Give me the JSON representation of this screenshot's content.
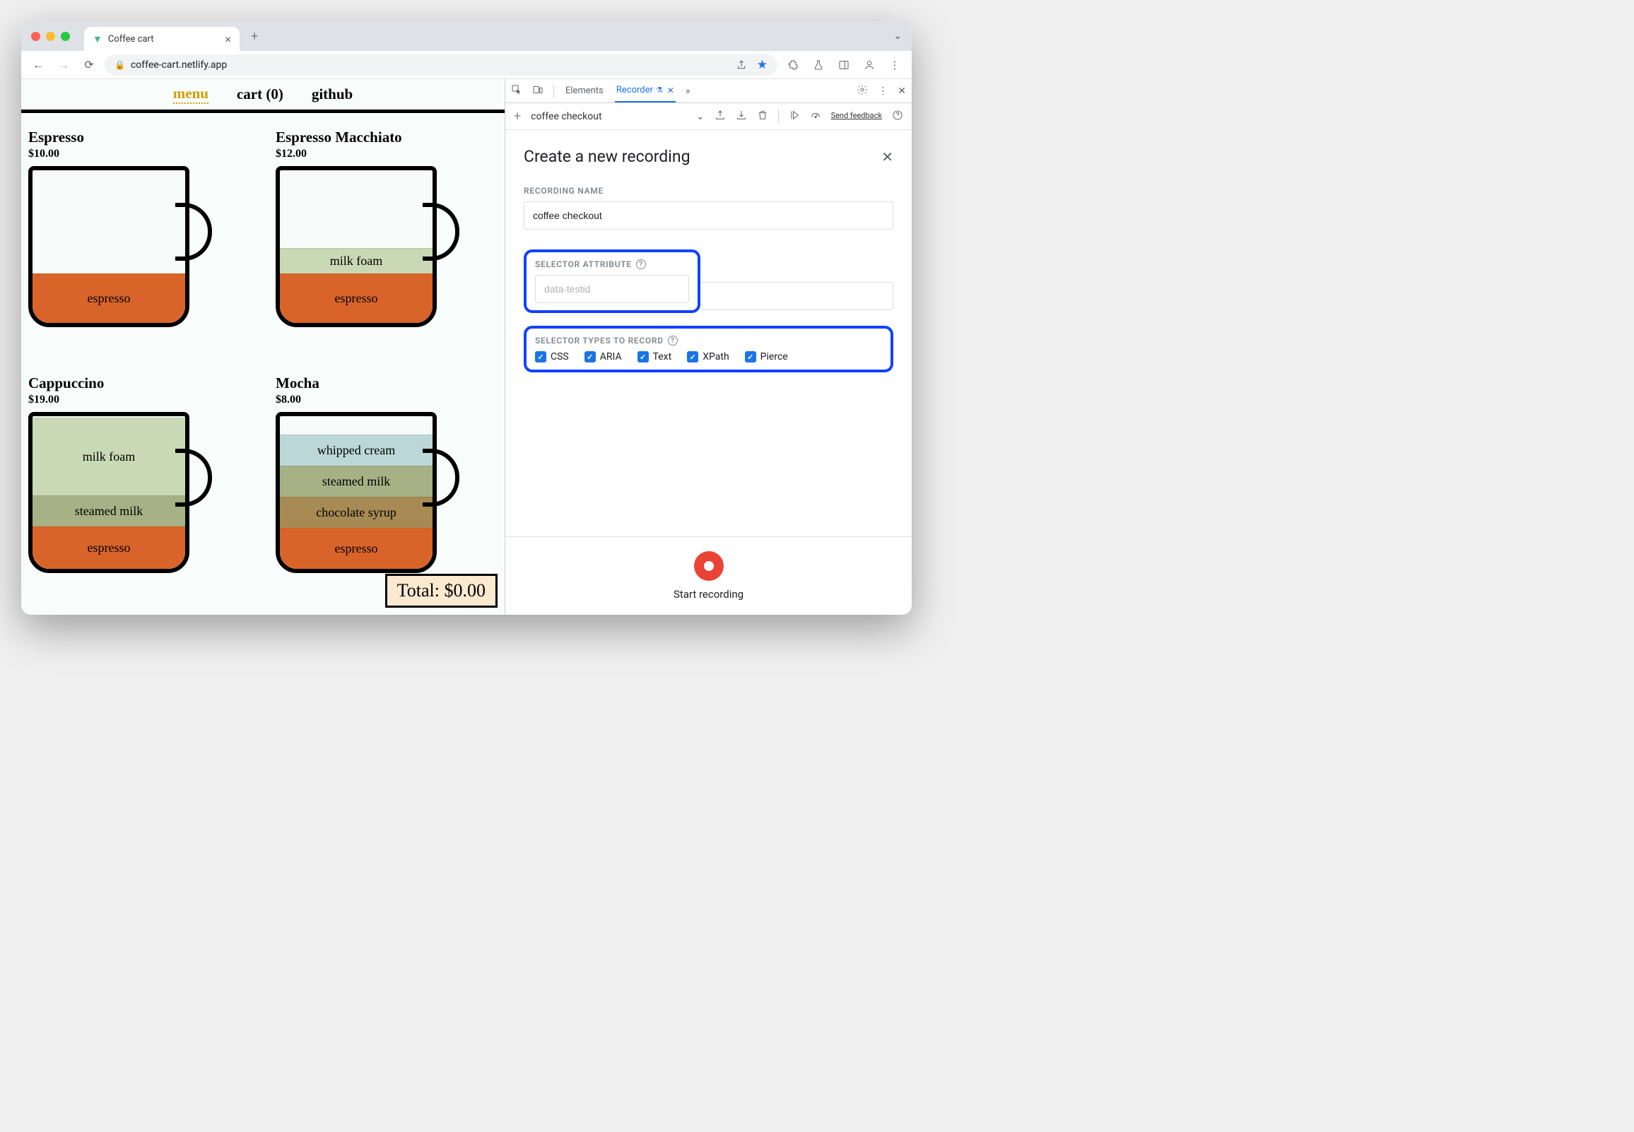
{
  "browser": {
    "tab_title": "Coffee cart",
    "url": "coffee-cart.netlify.app"
  },
  "site": {
    "nav": {
      "menu": "menu",
      "cart": "cart (0)",
      "github": "github"
    },
    "total_label": "Total: $0.00"
  },
  "products": [
    {
      "name": "Espresso",
      "price": "$10.00",
      "layers": [
        {
          "label": "espresso",
          "cls": "c-espresso",
          "h": 70
        }
      ]
    },
    {
      "name": "Espresso Macchiato",
      "price": "$12.00",
      "layers": [
        {
          "label": "milk foam",
          "cls": "c-milkfoam",
          "h": 36
        },
        {
          "label": "espresso",
          "cls": "c-espresso",
          "h": 70
        }
      ]
    },
    {
      "name": "Cappuccino",
      "price": "$19.00",
      "layers": [
        {
          "label": "milk foam",
          "cls": "c-milkfoam",
          "h": 110
        },
        {
          "label": "steamed milk",
          "cls": "c-steamed",
          "h": 44
        },
        {
          "label": "espresso",
          "cls": "c-espresso",
          "h": 60
        }
      ]
    },
    {
      "name": "Mocha",
      "price": "$8.00",
      "layers": [
        {
          "label": "whipped cream",
          "cls": "c-whipped",
          "h": 44
        },
        {
          "label": "steamed milk",
          "cls": "c-steamed",
          "h": 44
        },
        {
          "label": "chocolate syrup",
          "cls": "c-choc",
          "h": 44
        },
        {
          "label": "espresso",
          "cls": "c-espresso",
          "h": 58
        }
      ]
    }
  ],
  "devtools": {
    "tabs": {
      "elements": "Elements",
      "recorder": "Recorder"
    },
    "toolbar": {
      "recording_name": "coffee checkout",
      "feedback": "Send feedback"
    },
    "panel": {
      "heading": "Create a new recording",
      "name_label": "RECORDING NAME",
      "name_value": "coffee checkout",
      "selector_attr_label": "SELECTOR ATTRIBUTE",
      "selector_attr_placeholder": "data-testid",
      "types_label": "SELECTOR TYPES TO RECORD",
      "types": {
        "css": "CSS",
        "aria": "ARIA",
        "text": "Text",
        "xpath": "XPath",
        "pierce": "Pierce"
      },
      "start": "Start recording"
    }
  }
}
